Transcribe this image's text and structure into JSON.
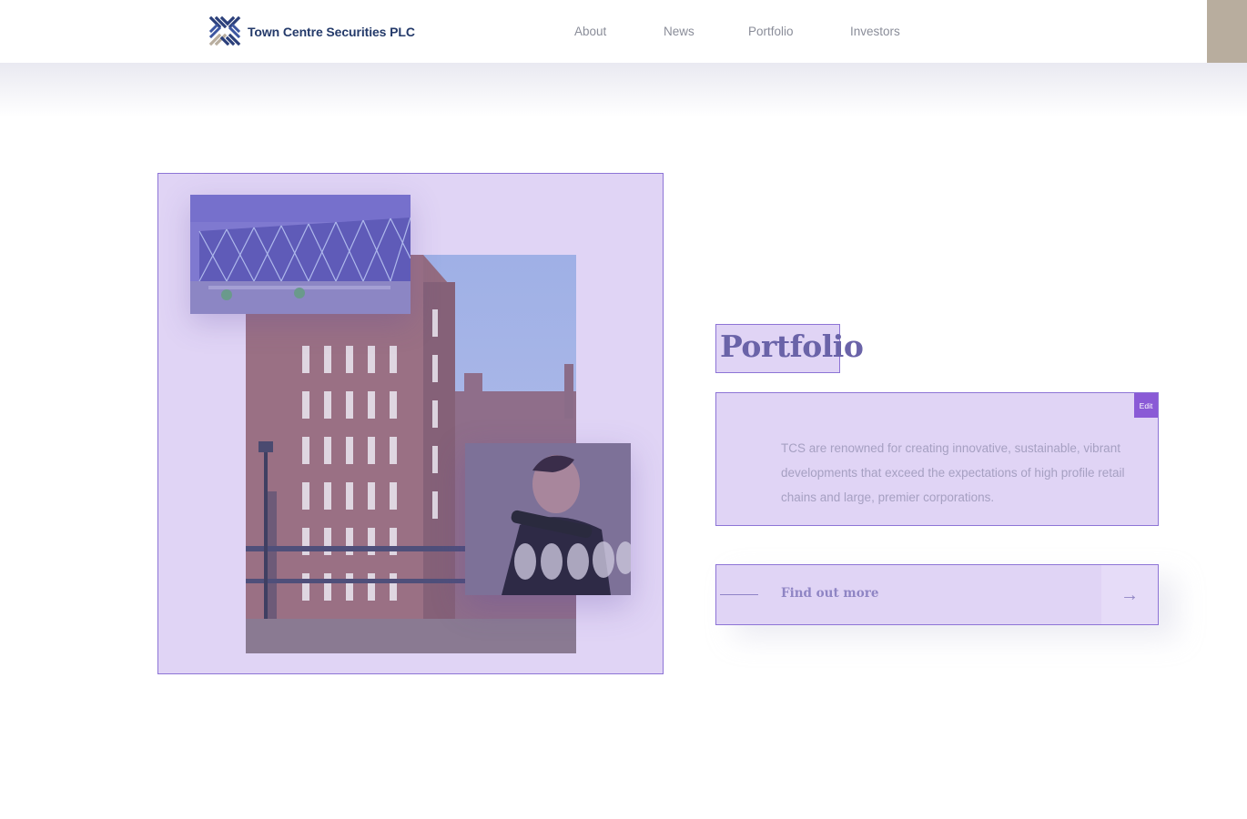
{
  "header": {
    "brand": "Town Centre Securities PLC",
    "nav": [
      "About",
      "News",
      "Portfolio",
      "Investors"
    ]
  },
  "colors": {
    "brand_navy": "#243a6a",
    "accent_taupe": "#b8ad9e",
    "overlay_lavender": "#e0d4f5",
    "overlay_border": "#8d74d6",
    "edit_badge": "#8a5ad6"
  },
  "portfolio": {
    "heading": "Portfolio",
    "edit_label": "Edit",
    "description": "TCS are renowned for creating innovative, sustainable, vibrant developments that exceed the expectations of high profile retail chains and large, premier corporations.",
    "cta_label": "Find out more",
    "cta_icon": "arrow-right-icon"
  },
  "icons": {
    "logo": "tcs-logo-icon",
    "arrow": "arrow-right-icon"
  }
}
